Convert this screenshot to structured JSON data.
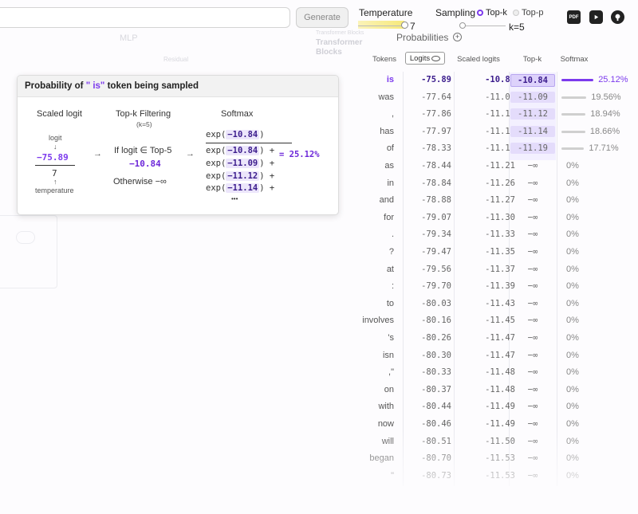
{
  "top": {
    "generate_label": "Generate",
    "temperature_label": "Temperature",
    "temperature_value": "7",
    "sampling_label": "Sampling",
    "option_topk": "Top-k",
    "option_topp": "Top-p",
    "k_value": "k=5",
    "pdf_icon_text": "PDF"
  },
  "background": {
    "mlp": "MLP",
    "residual": "Residual",
    "blocks": "Transformer\nBlocks",
    "blocks_sub": "Transformer Blocks"
  },
  "panel": {
    "title": "Probabilities",
    "headers": {
      "tokens": "Tokens",
      "logits": "Logits",
      "scaled": "Scaled logits",
      "topk": "Top-k",
      "softmax": "Softmax"
    },
    "rows": [
      {
        "token": "is",
        "logit": "-75.89",
        "scaled": "-10.84",
        "topk": "-10.84",
        "softmax": "25.12%",
        "p": 0.2512,
        "in_topk": true,
        "selected": true
      },
      {
        "token": "was",
        "logit": "-77.64",
        "scaled": "-11.09",
        "topk": "-11.09",
        "softmax": "19.56%",
        "p": 0.1956,
        "in_topk": true
      },
      {
        "token": ",",
        "logit": "-77.86",
        "scaled": "-11.12",
        "topk": "-11.12",
        "softmax": "18.94%",
        "p": 0.1894,
        "in_topk": true
      },
      {
        "token": "has",
        "logit": "-77.97",
        "scaled": "-11.14",
        "topk": "-11.14",
        "softmax": "18.66%",
        "p": 0.1866,
        "in_topk": true
      },
      {
        "token": "of",
        "logit": "-78.33",
        "scaled": "-11.19",
        "topk": "-11.19",
        "softmax": "17.71%",
        "p": 0.1771,
        "in_topk": true
      },
      {
        "token": "as",
        "logit": "-78.44",
        "scaled": "-11.21",
        "topk": "−∞",
        "softmax": "0%",
        "p": 0
      },
      {
        "token": "in",
        "logit": "-78.84",
        "scaled": "-11.26",
        "topk": "−∞",
        "softmax": "0%",
        "p": 0
      },
      {
        "token": "and",
        "logit": "-78.88",
        "scaled": "-11.27",
        "topk": "−∞",
        "softmax": "0%",
        "p": 0
      },
      {
        "token": "for",
        "logit": "-79.07",
        "scaled": "-11.30",
        "topk": "−∞",
        "softmax": "0%",
        "p": 0
      },
      {
        "token": ".",
        "logit": "-79.34",
        "scaled": "-11.33",
        "topk": "−∞",
        "softmax": "0%",
        "p": 0
      },
      {
        "token": "?",
        "logit": "-79.47",
        "scaled": "-11.35",
        "topk": "−∞",
        "softmax": "0%",
        "p": 0
      },
      {
        "token": "at",
        "logit": "-79.56",
        "scaled": "-11.37",
        "topk": "−∞",
        "softmax": "0%",
        "p": 0
      },
      {
        "token": ":",
        "logit": "-79.70",
        "scaled": "-11.39",
        "topk": "−∞",
        "softmax": "0%",
        "p": 0
      },
      {
        "token": "to",
        "logit": "-80.03",
        "scaled": "-11.43",
        "topk": "−∞",
        "softmax": "0%",
        "p": 0
      },
      {
        "token": "involves",
        "logit": "-80.16",
        "scaled": "-11.45",
        "topk": "−∞",
        "softmax": "0%",
        "p": 0
      },
      {
        "token": "'s",
        "logit": "-80.26",
        "scaled": "-11.47",
        "topk": "−∞",
        "softmax": "0%",
        "p": 0
      },
      {
        "token": "isn",
        "logit": "-80.30",
        "scaled": "-11.47",
        "topk": "−∞",
        "softmax": "0%",
        "p": 0
      },
      {
        "token": ",\"",
        "logit": "-80.33",
        "scaled": "-11.48",
        "topk": "−∞",
        "softmax": "0%",
        "p": 0
      },
      {
        "token": "on",
        "logit": "-80.37",
        "scaled": "-11.48",
        "topk": "−∞",
        "softmax": "0%",
        "p": 0
      },
      {
        "token": "with",
        "logit": "-80.44",
        "scaled": "-11.49",
        "topk": "−∞",
        "softmax": "0%",
        "p": 0
      },
      {
        "token": "now",
        "logit": "-80.46",
        "scaled": "-11.49",
        "topk": "−∞",
        "softmax": "0%",
        "p": 0
      },
      {
        "token": "will",
        "logit": "-80.51",
        "scaled": "-11.50",
        "topk": "−∞",
        "softmax": "0%",
        "p": 0
      },
      {
        "token": "began",
        "logit": "-80.70",
        "scaled": "-11.53",
        "topk": "−∞",
        "softmax": "0%",
        "p": 0
      },
      {
        "token": "\"",
        "logit": "-80.73",
        "scaled": "-11.53",
        "topk": "−∞",
        "softmax": "0%",
        "p": 0
      }
    ]
  },
  "card": {
    "title_pre": "Probability of",
    "title_token": "\" is\"",
    "title_post": "token being sampled",
    "scaled_logit_h": "Scaled logit",
    "topk_h": "Top-k Filtering",
    "topk_sub": "(k=5)",
    "softmax_h": "Softmax",
    "logit_lbl": "logit",
    "logit_val": "−75.89",
    "temp_val": "7",
    "temp_lbl": "temperature",
    "down_arrow": "↓",
    "up_arrow": "↑",
    "right_arrow": "→",
    "if_text": "If logit ∈ Top-5",
    "if_val": "−10.84",
    "otherwise_text": "Otherwise −∞",
    "exp_num_pre": "exp(",
    "exp_num_val": "−10.84",
    "exp_num_post": ")",
    "den": [
      {
        "pre": "exp(",
        "val": "−10.84",
        "post": ") +"
      },
      {
        "pre": "exp(",
        "val": "−11.09",
        "post": ") +"
      },
      {
        "pre": "exp(",
        "val": "−11.12",
        "post": ") +"
      },
      {
        "pre": "exp(",
        "val": "−11.14",
        "post": ") +"
      }
    ],
    "ellipsis": "•••",
    "result": "= 25.12%"
  }
}
